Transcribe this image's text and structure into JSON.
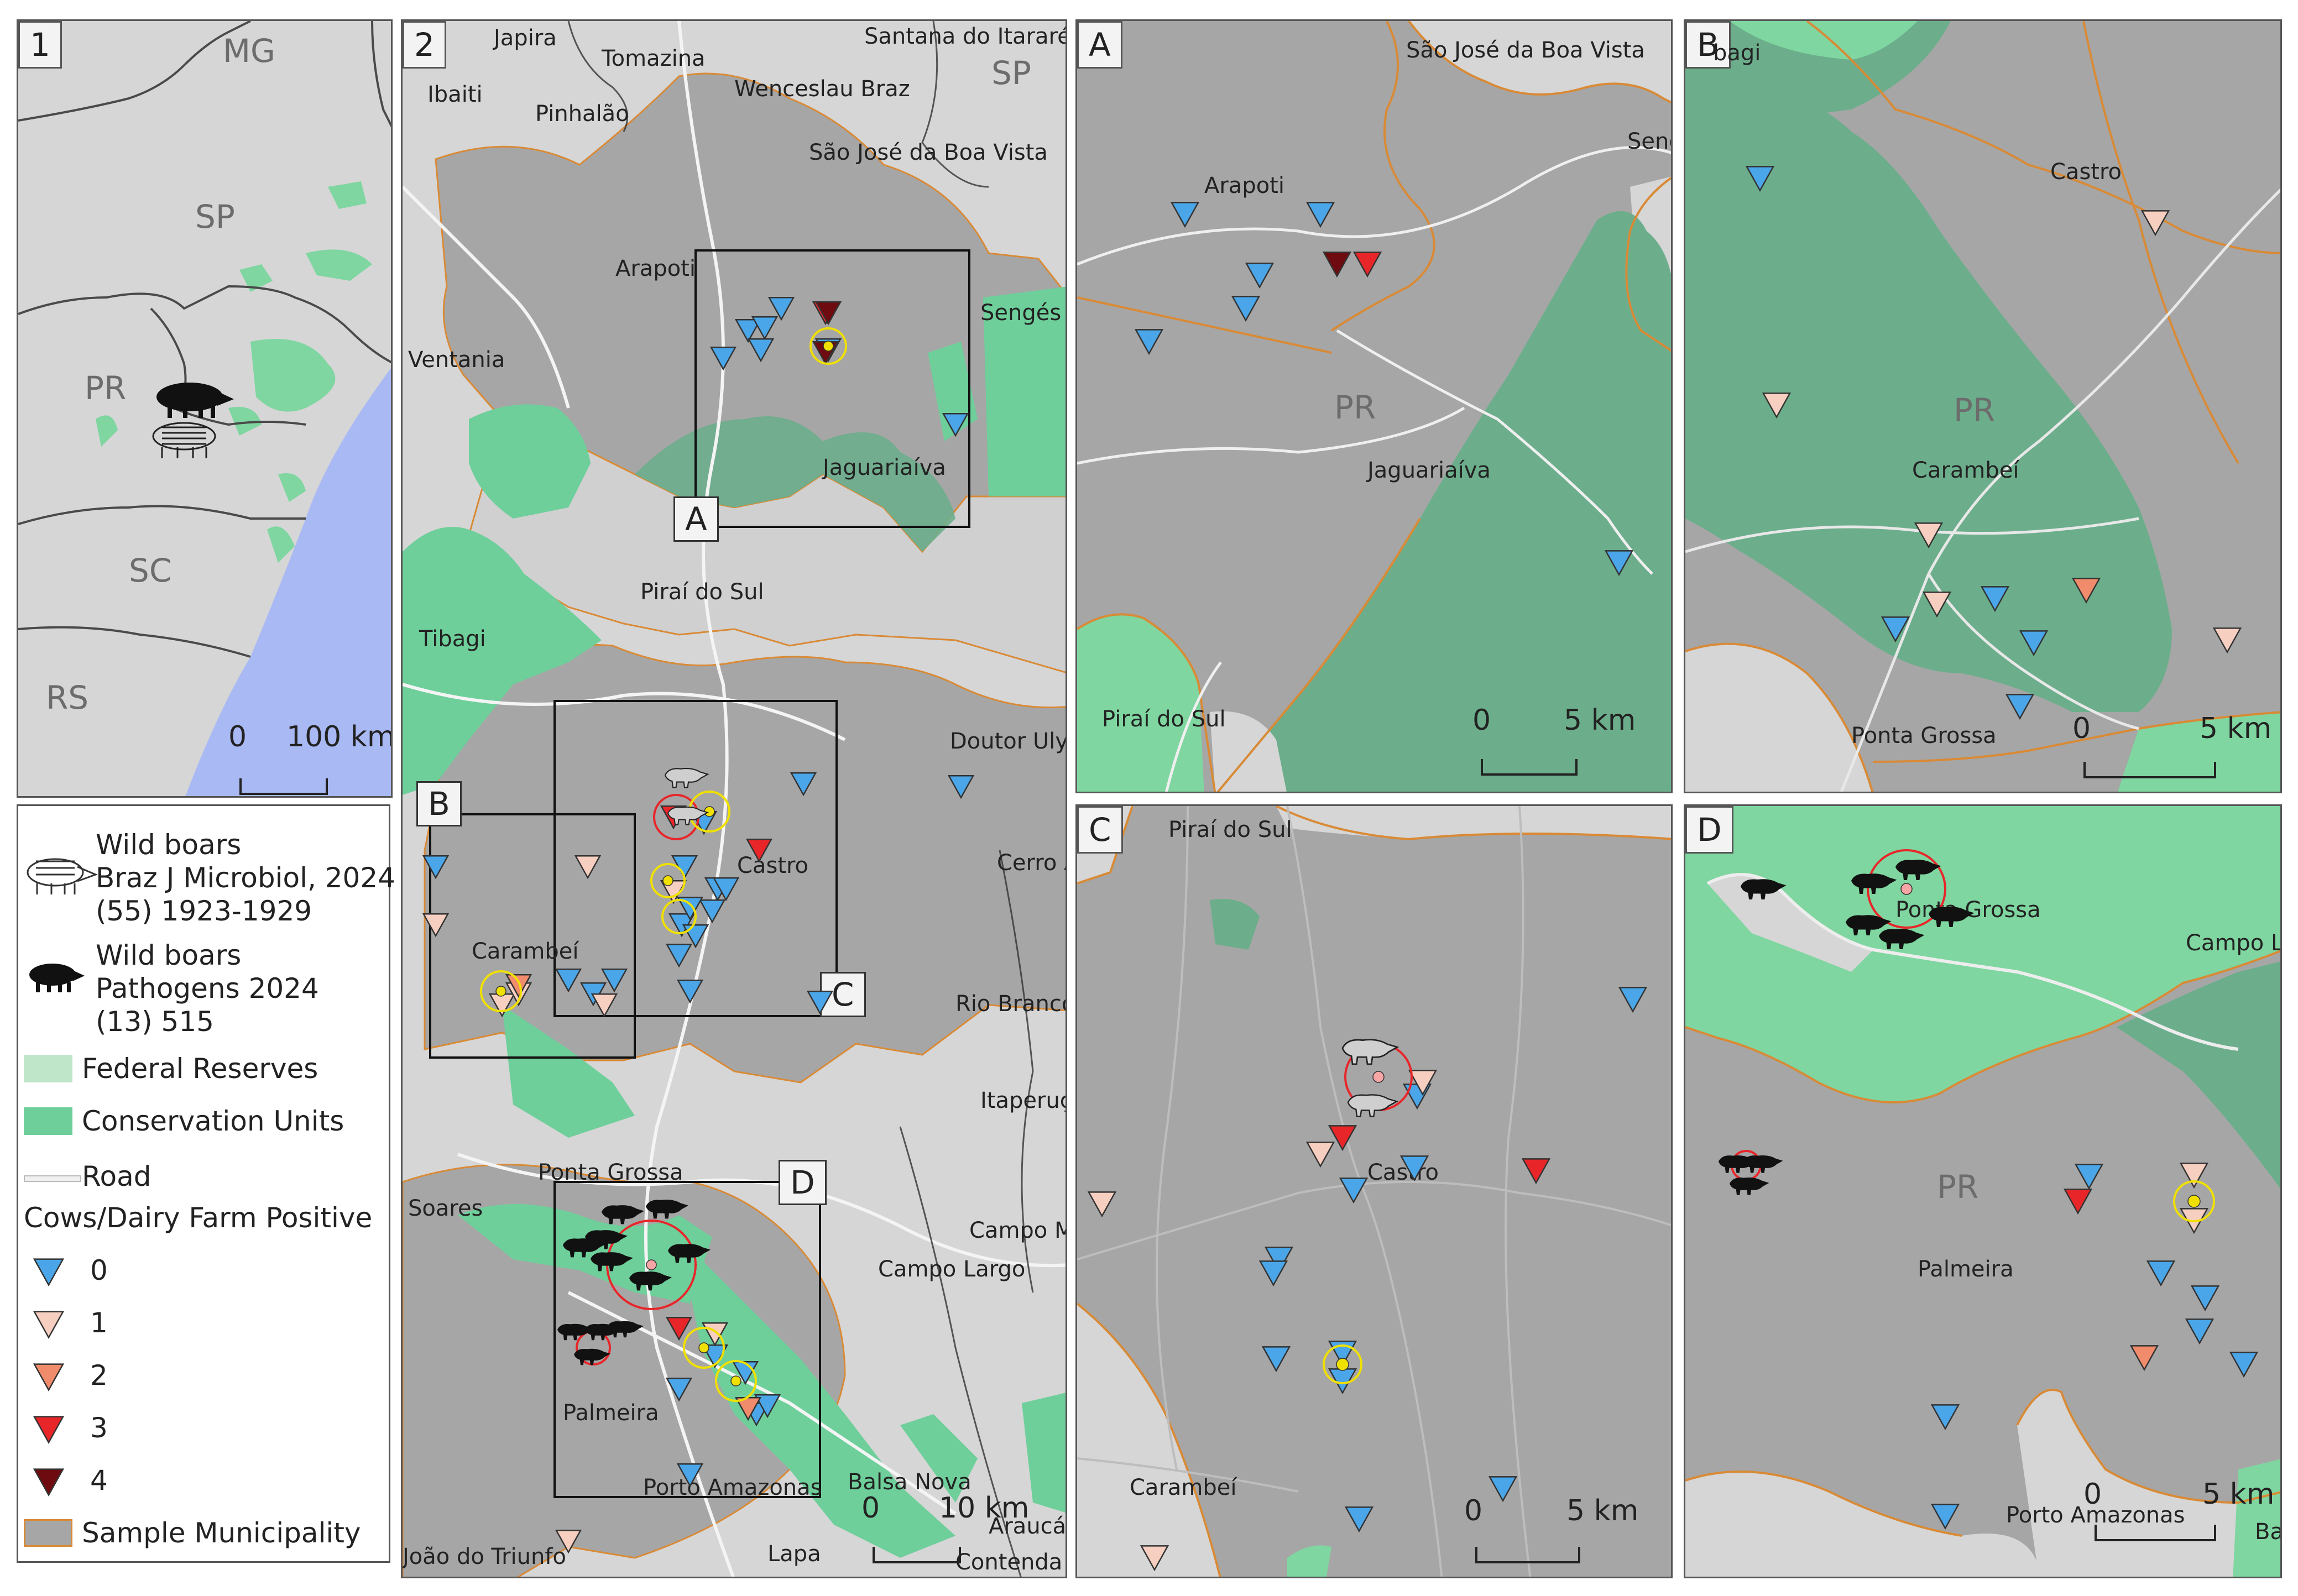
{
  "panels": {
    "p1": {
      "tag": "1",
      "scale": {
        "zero": "0",
        "end": "100 km"
      },
      "labels": {
        "mg": "MG",
        "sp": "SP",
        "pr": "PR",
        "sc": "SC",
        "rs": "RS"
      }
    },
    "p2": {
      "tag": "2",
      "scale": {
        "zero": "0",
        "end": "10 km"
      },
      "labels": [
        "Japira",
        "Tomazina",
        "Santana do Itararé",
        "SP",
        "Ibaiti",
        "Pinhalão",
        "Wenceslau Braz",
        "São José da Boa Vista",
        "Arapoti",
        "Sengés",
        "Ventania",
        "Jaguariaíva",
        "Piraí do Sul",
        "Tibagi",
        "Doutor Ulyss",
        "Castro",
        "Carambeí",
        "Cerro A",
        "Rio Branco",
        "Itaperuçu",
        "Ponta Grossa",
        "Soares",
        "Campo Ma",
        "Campo Largo",
        "Palmeira",
        "Balsa Nova",
        "Porto Amazonas",
        "Araucár",
        "João do Triunfo",
        "Lapa",
        "Contenda"
      ],
      "boxes": [
        "A",
        "B",
        "C",
        "D"
      ]
    },
    "pA": {
      "tag": "A",
      "scale": {
        "zero": "0",
        "end": "5 km"
      },
      "labels": [
        "São José da Boa Vista",
        "Seng",
        "Arapoti",
        "PR",
        "Jaguariaíva",
        "Piraí do Sul"
      ]
    },
    "pB": {
      "tag": "B",
      "scale": {
        "zero": "0",
        "end": "5 km"
      },
      "labels": [
        "bagi",
        "Castro",
        "PR",
        "Carambeí",
        "Ponta Grossa"
      ]
    },
    "pC": {
      "tag": "C",
      "scale": {
        "zero": "0",
        "end": "5 km"
      },
      "labels": [
        "Piraí do Sul",
        "Castro",
        "Carambeí"
      ]
    },
    "pD": {
      "tag": "D",
      "scale": {
        "zero": "0",
        "end": "5 km"
      },
      "labels": [
        "Ponta Grossa",
        "Campo La",
        "PR",
        "Palmeira",
        "Porto Amazonas",
        "Bals"
      ]
    }
  },
  "legend": {
    "boar1_line1": "Wild boars",
    "boar1_line2": "Braz J Microbiol, 2024",
    "boar1_line3": "(55) 1923-1929",
    "boar2_line1": "Wild boars",
    "boar2_line2": "Pathogens 2024",
    "boar2_line3": "(13) 515",
    "federal": "Federal Reserves",
    "conservation": "Conservation Units",
    "road": "Road",
    "cows_title": "Cows/Dairy Farm Positive",
    "classes": [
      {
        "label": "0",
        "color": "#4aa6e8"
      },
      {
        "label": "1",
        "color": "#f6cfc0"
      },
      {
        "label": "2",
        "color": "#f08c6c"
      },
      {
        "label": "3",
        "color": "#e8262a"
      },
      {
        "label": "4",
        "color": "#6e0b10"
      }
    ],
    "municipality": "Sample Municipality"
  },
  "colors": {
    "municipality_fill": "#a6a6a6",
    "background_land": "#d4d4d4",
    "conservation": "#6ecf9a",
    "federal": "#bfe6c9",
    "ocean": "#a6b9f4",
    "boundary": "#d98a36"
  }
}
